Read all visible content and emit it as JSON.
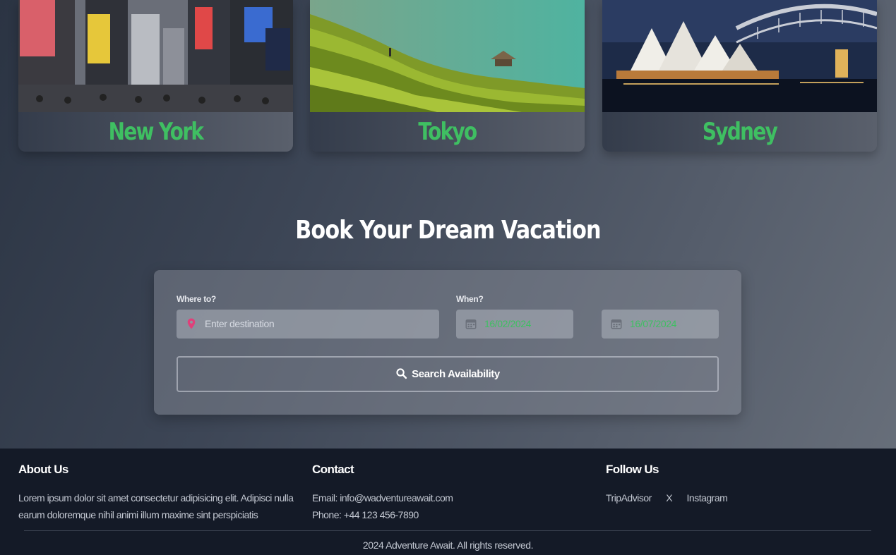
{
  "destinations": [
    {
      "city": "New York",
      "image": "new-york-times-square-photo"
    },
    {
      "city": "Tokyo",
      "image": "rice-terraces-photo"
    },
    {
      "city": "Sydney",
      "image": "sydney-opera-house-photo"
    }
  ],
  "booking": {
    "title": "Book Your Dream Vacation",
    "where_label": "Where to?",
    "destination_placeholder": "Enter destination",
    "when_label": "When?",
    "start_date": "16/02/2024",
    "end_date": "16/07/2024",
    "search_label": "Search Availability"
  },
  "footer": {
    "about_title": "About Us",
    "about_text": "Lorem ipsum dolor sit amet consectetur adipisicing elit. Adipisci nulla earum doloremque nihil animi illum maxime sint perspiciatis",
    "contact_title": "Contact",
    "email": "Email: info@wadventureawait.com",
    "phone": "Phone: +44 123 456-7890",
    "follow_title": "Follow Us",
    "social": [
      "TripAdvisor",
      "X",
      "Instagram"
    ],
    "copyright": "2024 Adventure Await. All rights reserved."
  },
  "colors": {
    "accent_green": "#3fbf62",
    "pin_pink": "#e0407a",
    "footer_bg": "#141a27"
  }
}
